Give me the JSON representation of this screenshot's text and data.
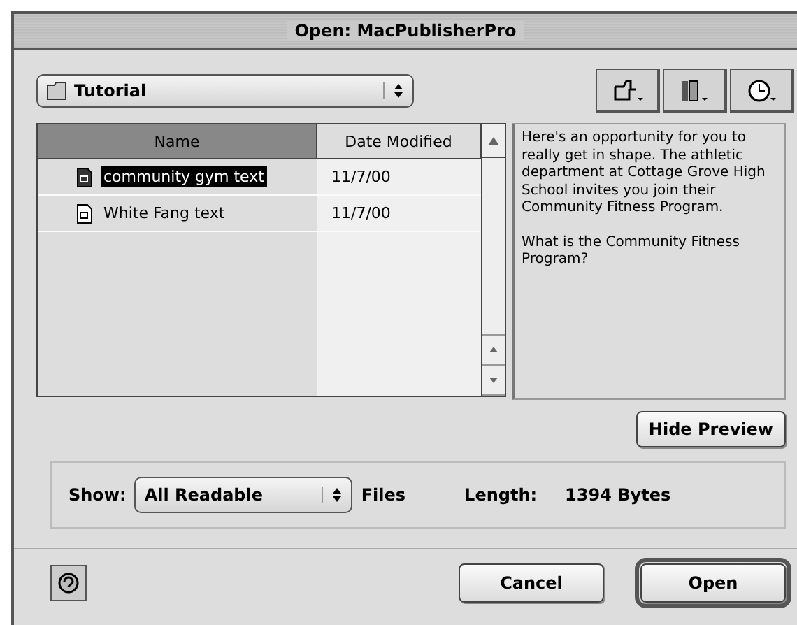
{
  "window": {
    "title": "Open: MacPublisherPro"
  },
  "folder_popup": {
    "value": "Tutorial"
  },
  "file_list": {
    "columns": [
      {
        "label": "Name",
        "selected": true
      },
      {
        "label": "Date Modified",
        "selected": false
      }
    ],
    "rows": [
      {
        "name": "community gym text",
        "date": "11/7/00",
        "selected": true
      },
      {
        "name": "White Fang text",
        "date": "11/7/00",
        "selected": false
      }
    ]
  },
  "preview": {
    "paragraphs": [
      "Here's an opportunity for you to really get in shape. The athletic department at Cottage Grove High School invites you join their Community Fitness Program.",
      "What is the Community Fitness Program?"
    ]
  },
  "hide_preview_button": "Hide Preview",
  "show": {
    "label": "Show:",
    "value": "All Readable",
    "suffix": "Files"
  },
  "length": {
    "label": "Length:",
    "value": "1394 Bytes"
  },
  "buttons": [
    {
      "label": "Cancel",
      "default": false
    },
    {
      "label": "Open",
      "default": true
    }
  ]
}
